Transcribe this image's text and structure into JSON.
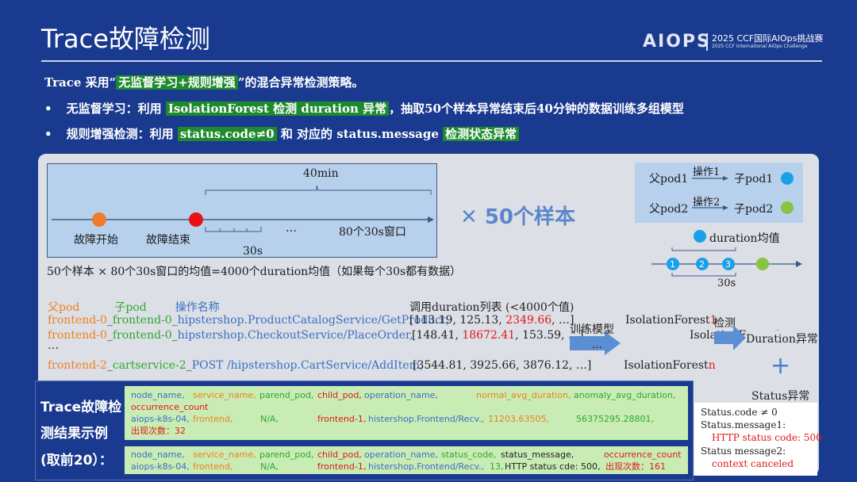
{
  "header": {
    "title": "Trace故障检测",
    "logo_text": "AIOPS",
    "logo_line1": "2025 CCF国际AIOps挑战赛",
    "logo_line2": "2025 CCF International AIOps Challenge"
  },
  "intro": {
    "prefix": "Trace 采用“",
    "highlight": "无监督学习+规则增强",
    "suffix": "”的混合异常检测策略。"
  },
  "bullet1": {
    "bullet": "•",
    "prefix": "无监督学习：利用 ",
    "highlight": "IsolationForest 检测 duration 异常",
    "suffix": "，抽取50个样本异常结束后40分钟的数据训练多组模型"
  },
  "bullet2": {
    "bullet": "•",
    "prefix": "规则增强检测：利用 ",
    "highlight1": "status.code≠0",
    "middle": " 和 对应的 status.message ",
    "highlight2": "检测状态异常"
  },
  "timeline": {
    "label_40min": "40min",
    "label_start": "故障开始",
    "label_end": "故障结束",
    "ellipsis": "…",
    "label_windows": "80个30s窗口",
    "label_30s": "30s",
    "caption": "50个样本 × 80个30s窗口的均值=4000个duration均值（如果每个30s都有数据）"
  },
  "times_50": "✕ 50个样本",
  "pods": {
    "parent1": "父pod1",
    "op1": "操作1",
    "child1": "子pod1",
    "parent2": "父pod2",
    "op2": "操作2",
    "child2": "子pod2",
    "colors": {
      "child1": "#1aa0e8",
      "child2": "#86c441"
    }
  },
  "duration_mean": {
    "label": "duration均值",
    "points": [
      "1",
      "2",
      "3"
    ],
    "window": "30s"
  },
  "table": {
    "headers": {
      "parent": "父pod",
      "child": "子pod",
      "op": "操作名称",
      "durations": "调用duration列表 (<4000个值)"
    },
    "rows": [
      {
        "parent": "frontend-0",
        "sep1": "_",
        "child": "frontend-0",
        "sep2": "_",
        "op": "hipstershop.ProductCatalogService/GetProduct,",
        "d_pre": "[113.19, 125.13, ",
        "d_hl": "2349.66",
        "d_post": ", …]"
      },
      {
        "parent": "frontend-0",
        "sep1": "_",
        "child": "frontend-0",
        "sep2": "_",
        "op": "hipstershop.CheckoutService/PlaceOrder,",
        "d_pre": "[148.41, ",
        "d_hl": "18672.41",
        "d_post": ", 153.59, …]"
      },
      {
        "parent": "frontend-2",
        "sep1": "_",
        "child": "cartservice-2",
        "sep2": "_",
        "op": "POST /hipstershop.CartService/AddItem,",
        "d_pre": "[3544.81, 3925.66, 3876.12, …]",
        "d_hl": "",
        "d_post": ""
      }
    ],
    "dots": "…"
  },
  "models": {
    "train_label": "训练模型",
    "train_dots": "…",
    "if1": "IsolationForest",
    "if1_n": "1",
    "detect": "检测",
    "if2": "IsolationForest",
    "if2_n": "2",
    "ifn": "IsolationForest",
    "ifn_n": "n",
    "duration_anomaly": "Duration异常",
    "plus": "+"
  },
  "status": {
    "title": "Status异常",
    "code": "Status.code ≠ 0",
    "msg1_label": "Status.message1:",
    "msg1_val": "HTTP status code: 500",
    "msg2_label": "Status message2:",
    "msg2_val": "context canceled"
  },
  "results": {
    "side_label1": "Trace故障检",
    "side_label2": "测结果示例",
    "side_label3": "(取前20）：",
    "box1": {
      "h_node": "node_name,",
      "h_service": "service_name,",
      "h_parent": "parend_pod,",
      "h_child": "child_pod,",
      "h_op": "operation_name,",
      "h_normal": "normal_avg_duration,",
      "h_anom": "anomaly_avg_duration,",
      "h_occ": "occurrence_count",
      "v_node": "aiops-k8s-04,",
      "v_service": "frontend,",
      "v_parent": "N/A,",
      "v_child": "frontend-1,",
      "v_op": "histershop.Frontend/Recv.,",
      "v_normal": "11203.63505,",
      "v_anom": "56375295.28801,",
      "v_occ": "出现次数：32"
    },
    "box2": {
      "h_node": "node_name,",
      "h_service": "service_name,",
      "h_parent": "parend_pod,",
      "h_child": "child_pod,",
      "h_op": "operation_name,",
      "h_code": "status_code,",
      "h_msg": "status_message,",
      "h_occ": "occurrence_count",
      "v_node": "aiops-k8s-04,",
      "v_service": "frontend,",
      "v_parent": "N/A,",
      "v_child": "frontend-1,",
      "v_op": "histershop.Frontend/Recv.,",
      "v_code": "13,",
      "v_msg": "HTTP status cde: 500,",
      "v_occ": "出现次数：161"
    }
  }
}
